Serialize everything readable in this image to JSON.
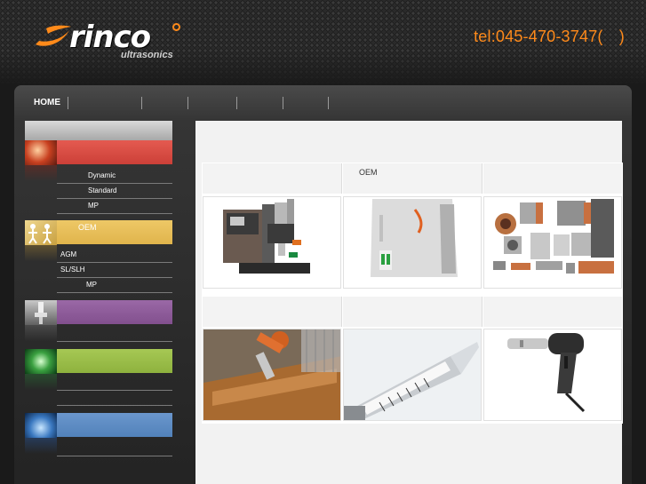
{
  "header": {
    "logo": {
      "word": "rinco",
      "sub": "ultrasonics"
    },
    "tel": "tel:045-470-3747(　)"
  },
  "nav": {
    "items": [
      {
        "label": "HOME"
      },
      {
        "label": ""
      },
      {
        "label": ""
      },
      {
        "label": ""
      },
      {
        "label": ""
      },
      {
        "label": ""
      },
      {
        "label": ""
      }
    ]
  },
  "sidebar": {
    "sections": [
      {
        "color": "#e0504a",
        "label": "",
        "items": [
          {
            "label": "Dynamic"
          },
          {
            "label": "Standard"
          },
          {
            "label": "MP"
          }
        ]
      },
      {
        "color": "#e8c05a",
        "label": "OEM",
        "items": [
          {
            "label": "AGM"
          },
          {
            "label": "SL/SLH"
          },
          {
            "label": "MP"
          }
        ]
      },
      {
        "color": "#8a5a96",
        "label": "",
        "items": [
          {
            "label": ""
          }
        ]
      },
      {
        "color": "#9cc04a",
        "label": "",
        "items": [
          {
            "label": ""
          },
          {
            "label": ""
          }
        ]
      },
      {
        "color": "#5a8ac6",
        "label": "",
        "items": [
          {
            "label": ""
          }
        ]
      }
    ]
  },
  "products": {
    "row1": [
      {
        "title": "",
        "image": "welding-machine"
      },
      {
        "title": "OEM",
        "image": "generator-unit"
      },
      {
        "title": "",
        "image": "sonotrode-tools"
      }
    ],
    "row2": [
      {
        "title": "",
        "image": "robot-application"
      },
      {
        "title": "",
        "image": "syringe-application"
      },
      {
        "title": "",
        "image": "handheld-welder"
      }
    ]
  },
  "colors": {
    "accent": "#ff8a1a",
    "content_bg": "#f2f2f2"
  }
}
